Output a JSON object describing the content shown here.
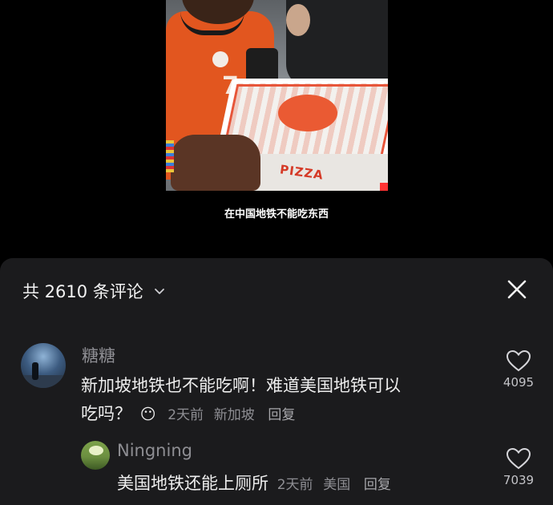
{
  "video": {
    "subtitle": "在中国地铁不能吃东西",
    "shirt_number": "7",
    "box_text": "PIZZA"
  },
  "comments_panel": {
    "title": "共 2610 条评论",
    "chevron_icon": "chevron-down-icon",
    "close_icon": "close-icon"
  },
  "comments": [
    {
      "username": "糖糖",
      "line1": "新加坡地铁也不能吃啊！难道美国地铁可以",
      "line2": "吃吗？",
      "emoji": "😶",
      "time": "2天前",
      "location": "新加坡",
      "reply_label": "回复",
      "likes": "4095"
    },
    {
      "username": "Ningning",
      "text": "美国地铁还能上厕所",
      "time": "2天前",
      "location": "美国",
      "reply_label": "回复",
      "likes": "7039"
    }
  ],
  "colors": {
    "sheet_bg": "#1b1b1d",
    "muted_text": "#8e8e93",
    "body_text": "#eeeeee"
  }
}
